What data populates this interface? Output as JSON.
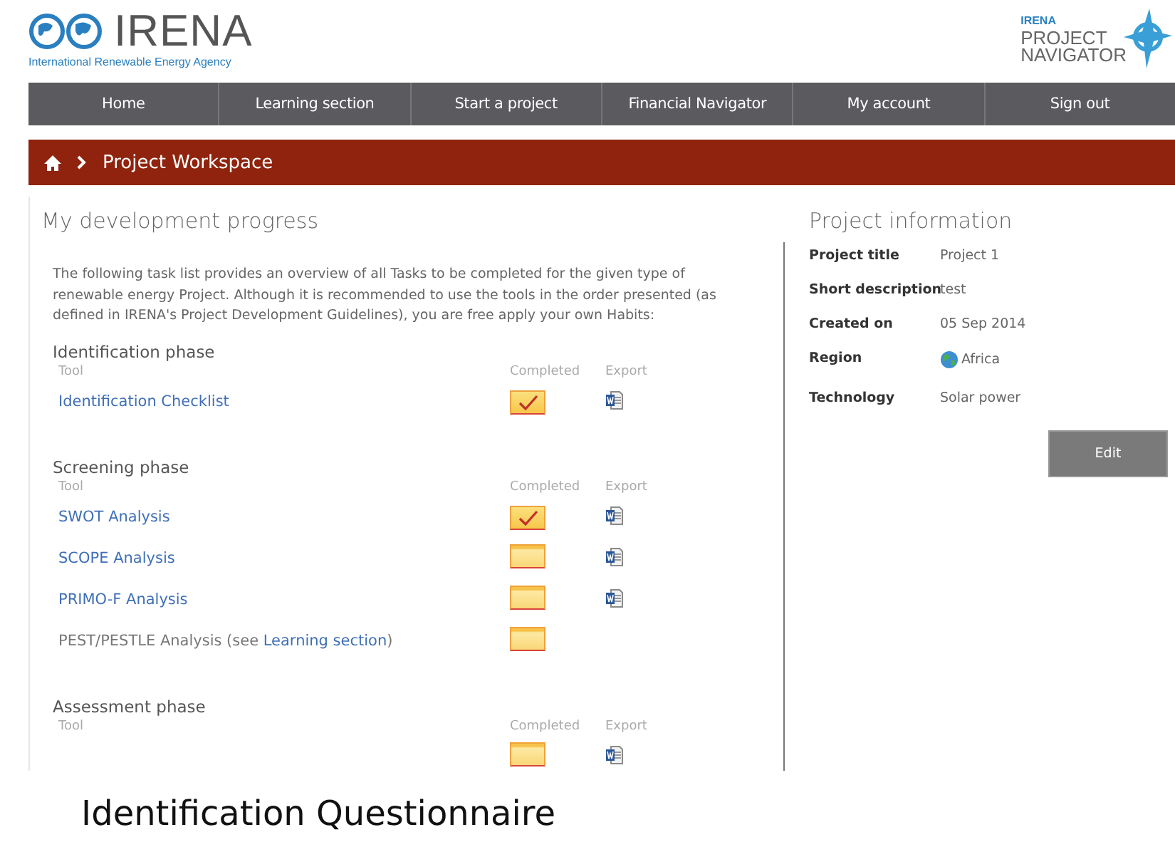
{
  "logo": {
    "name": "IRENA",
    "tagline": "International Renewable Energy Agency"
  },
  "product_logo": {
    "org": "IRENA",
    "lines": [
      "PROJECT",
      "NAVIGATOR"
    ]
  },
  "nav": [
    {
      "label": "Home"
    },
    {
      "label": "Learning section"
    },
    {
      "label": "Start a project"
    },
    {
      "label": "Financial Navigator"
    },
    {
      "label": "My account"
    },
    {
      "label": "Sign out"
    }
  ],
  "breadcrumb": {
    "current": "Project Workspace"
  },
  "progress": {
    "title": "My development progress",
    "intro": "The following task list provides an overview of all Tasks to be completed for the given type of renewable energy Project. Although it is recommended to use the tools in the order presented (as defined in IRENA's Project Development Guidelines), you are free apply your own Habits:",
    "phases": [
      {
        "title": "Identification phase",
        "columns": [
          "Tool",
          "Completed",
          "Export"
        ],
        "tools": [
          {
            "kind": "link",
            "name": "Identification Checklist",
            "completed": true,
            "export": true
          }
        ]
      },
      {
        "title": "Screening phase",
        "columns": [
          "Tool",
          "Completed",
          "Export"
        ],
        "tools": [
          {
            "kind": "link",
            "name": "SWOT Analysis",
            "completed": true,
            "export": true
          },
          {
            "kind": "link",
            "name": "SCOPE Analysis",
            "completed": false,
            "export": true
          },
          {
            "kind": "link",
            "name": "PRIMO-F Analysis",
            "completed": false,
            "export": true
          },
          {
            "kind": "note",
            "name": "PEST/PESTLE Analysis (see ",
            "link": "Learning section",
            "after": ")",
            "completed": false,
            "export": false
          }
        ]
      },
      {
        "title": "Assessment phase",
        "columns": [
          "Tool",
          "Completed",
          "Export"
        ],
        "tools": [
          {
            "kind": "link",
            "completed": false,
            "export": true
          }
        ]
      }
    ]
  },
  "project_info": {
    "title": "Project information",
    "fields": [
      {
        "kind": "text",
        "label": "Project title",
        "value": "Project 1"
      },
      {
        "kind": "text",
        "label": "Short description",
        "value": "test"
      },
      {
        "kind": "text",
        "label": "Created on",
        "value": "05 Sep 2014"
      },
      {
        "kind": "region",
        "label": "Region",
        "value": "Africa"
      },
      {
        "kind": "text",
        "label": "Technology",
        "value": "Solar power"
      }
    ],
    "edit_button": "Edit"
  },
  "caption": "Identification Questionnaire"
}
